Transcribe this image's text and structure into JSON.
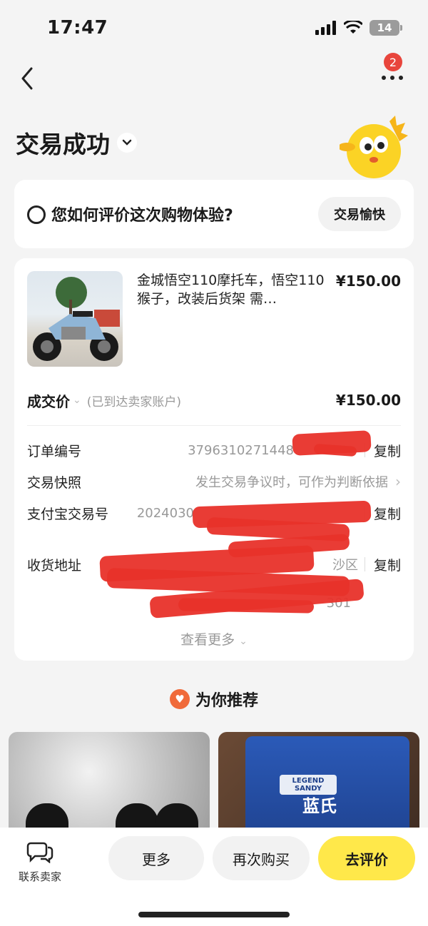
{
  "status_bar": {
    "time": "17:47",
    "battery": "14"
  },
  "nav": {
    "badge_count": "2"
  },
  "header": {
    "title": "交易成功"
  },
  "rating": {
    "question": "您如何评价这次购物体验?",
    "button_label": "交易愉快"
  },
  "product": {
    "title": "金城悟空110摩托车，悟空110猴子，改装后货架 需…",
    "price": "¥150.00"
  },
  "deal": {
    "label": "成交价",
    "sub": "(已到达卖家账户)",
    "price": "¥150.00"
  },
  "details": {
    "order_no": {
      "label": "订单编号",
      "value": "3796310271448",
      "action": "复制"
    },
    "snapshot": {
      "label": "交易快照",
      "value": "发生交易争议时，可作为判断依据"
    },
    "alipay": {
      "label": "支付宝交易号",
      "value": "2024030",
      "action": "复制"
    },
    "address": {
      "label": "收货地址",
      "value_tail": "沙区",
      "value_tail2": "301",
      "action": "复制"
    }
  },
  "see_more": "查看更多",
  "recommend": {
    "title": "为你推荐",
    "item2_badge": "LEGEND SANDY",
    "item2_brand": "蓝氏"
  },
  "bottom": {
    "contact": "联系卖家",
    "more": "更多",
    "rebuy": "再次购买",
    "review": "去评价"
  },
  "colors": {
    "accent_yellow": "#ffe84a",
    "badge_red": "#e8453c",
    "redaction": "#e8312a"
  }
}
